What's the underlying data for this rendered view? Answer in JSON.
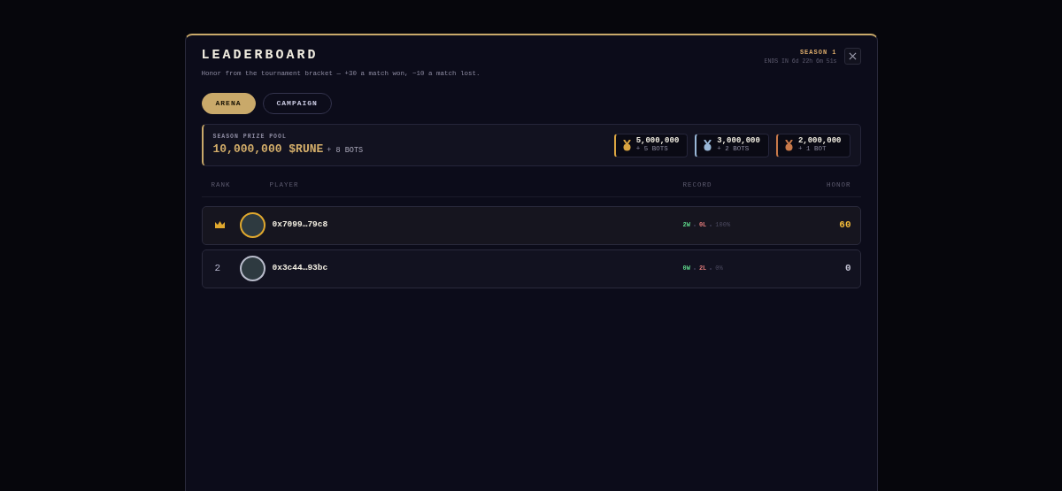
{
  "modal": {
    "title": "LEADERBOARD",
    "subtitle": "Honor from the tournament bracket — +30 a match won, −10 a match lost.",
    "season": "SEASON 1",
    "ends": "ENDS IN 6d 22h 6m 51s",
    "tabs": [
      {
        "label": "ARENA",
        "selected": true
      },
      {
        "label": "CAMPAIGN",
        "selected": false
      }
    ],
    "prize_pool": {
      "label": "SEASON PRIZE POOL",
      "amount": "10,000,000 $RUNE",
      "extra": "+ 8 BOTS",
      "tiers": [
        {
          "amount": "5,000,000",
          "bots": "+ 5 BOTS",
          "color": "#d9a441"
        },
        {
          "amount": "3,000,000",
          "bots": "+ 2 BOTS",
          "color": "#9ab8d8"
        },
        {
          "amount": "2,000,000",
          "bots": "+ 1 BOT",
          "color": "#c8794a"
        }
      ]
    },
    "table": {
      "columns": [
        "RANK",
        "PLAYER",
        "RECORD",
        "HONOR"
      ],
      "rows": [
        {
          "crowned": true,
          "rank": "",
          "player": "0x7099…79c8",
          "wins": "2W",
          "losses": "0L",
          "rate": "100%",
          "honor": "60",
          "color": "#e0a82e"
        },
        {
          "crowned": false,
          "rank": "2",
          "player": "0x3c44…93bc",
          "wins": "0W",
          "losses": "2L",
          "rate": "0%",
          "honor": "0",
          "color": "#b9bccb"
        }
      ]
    }
  }
}
